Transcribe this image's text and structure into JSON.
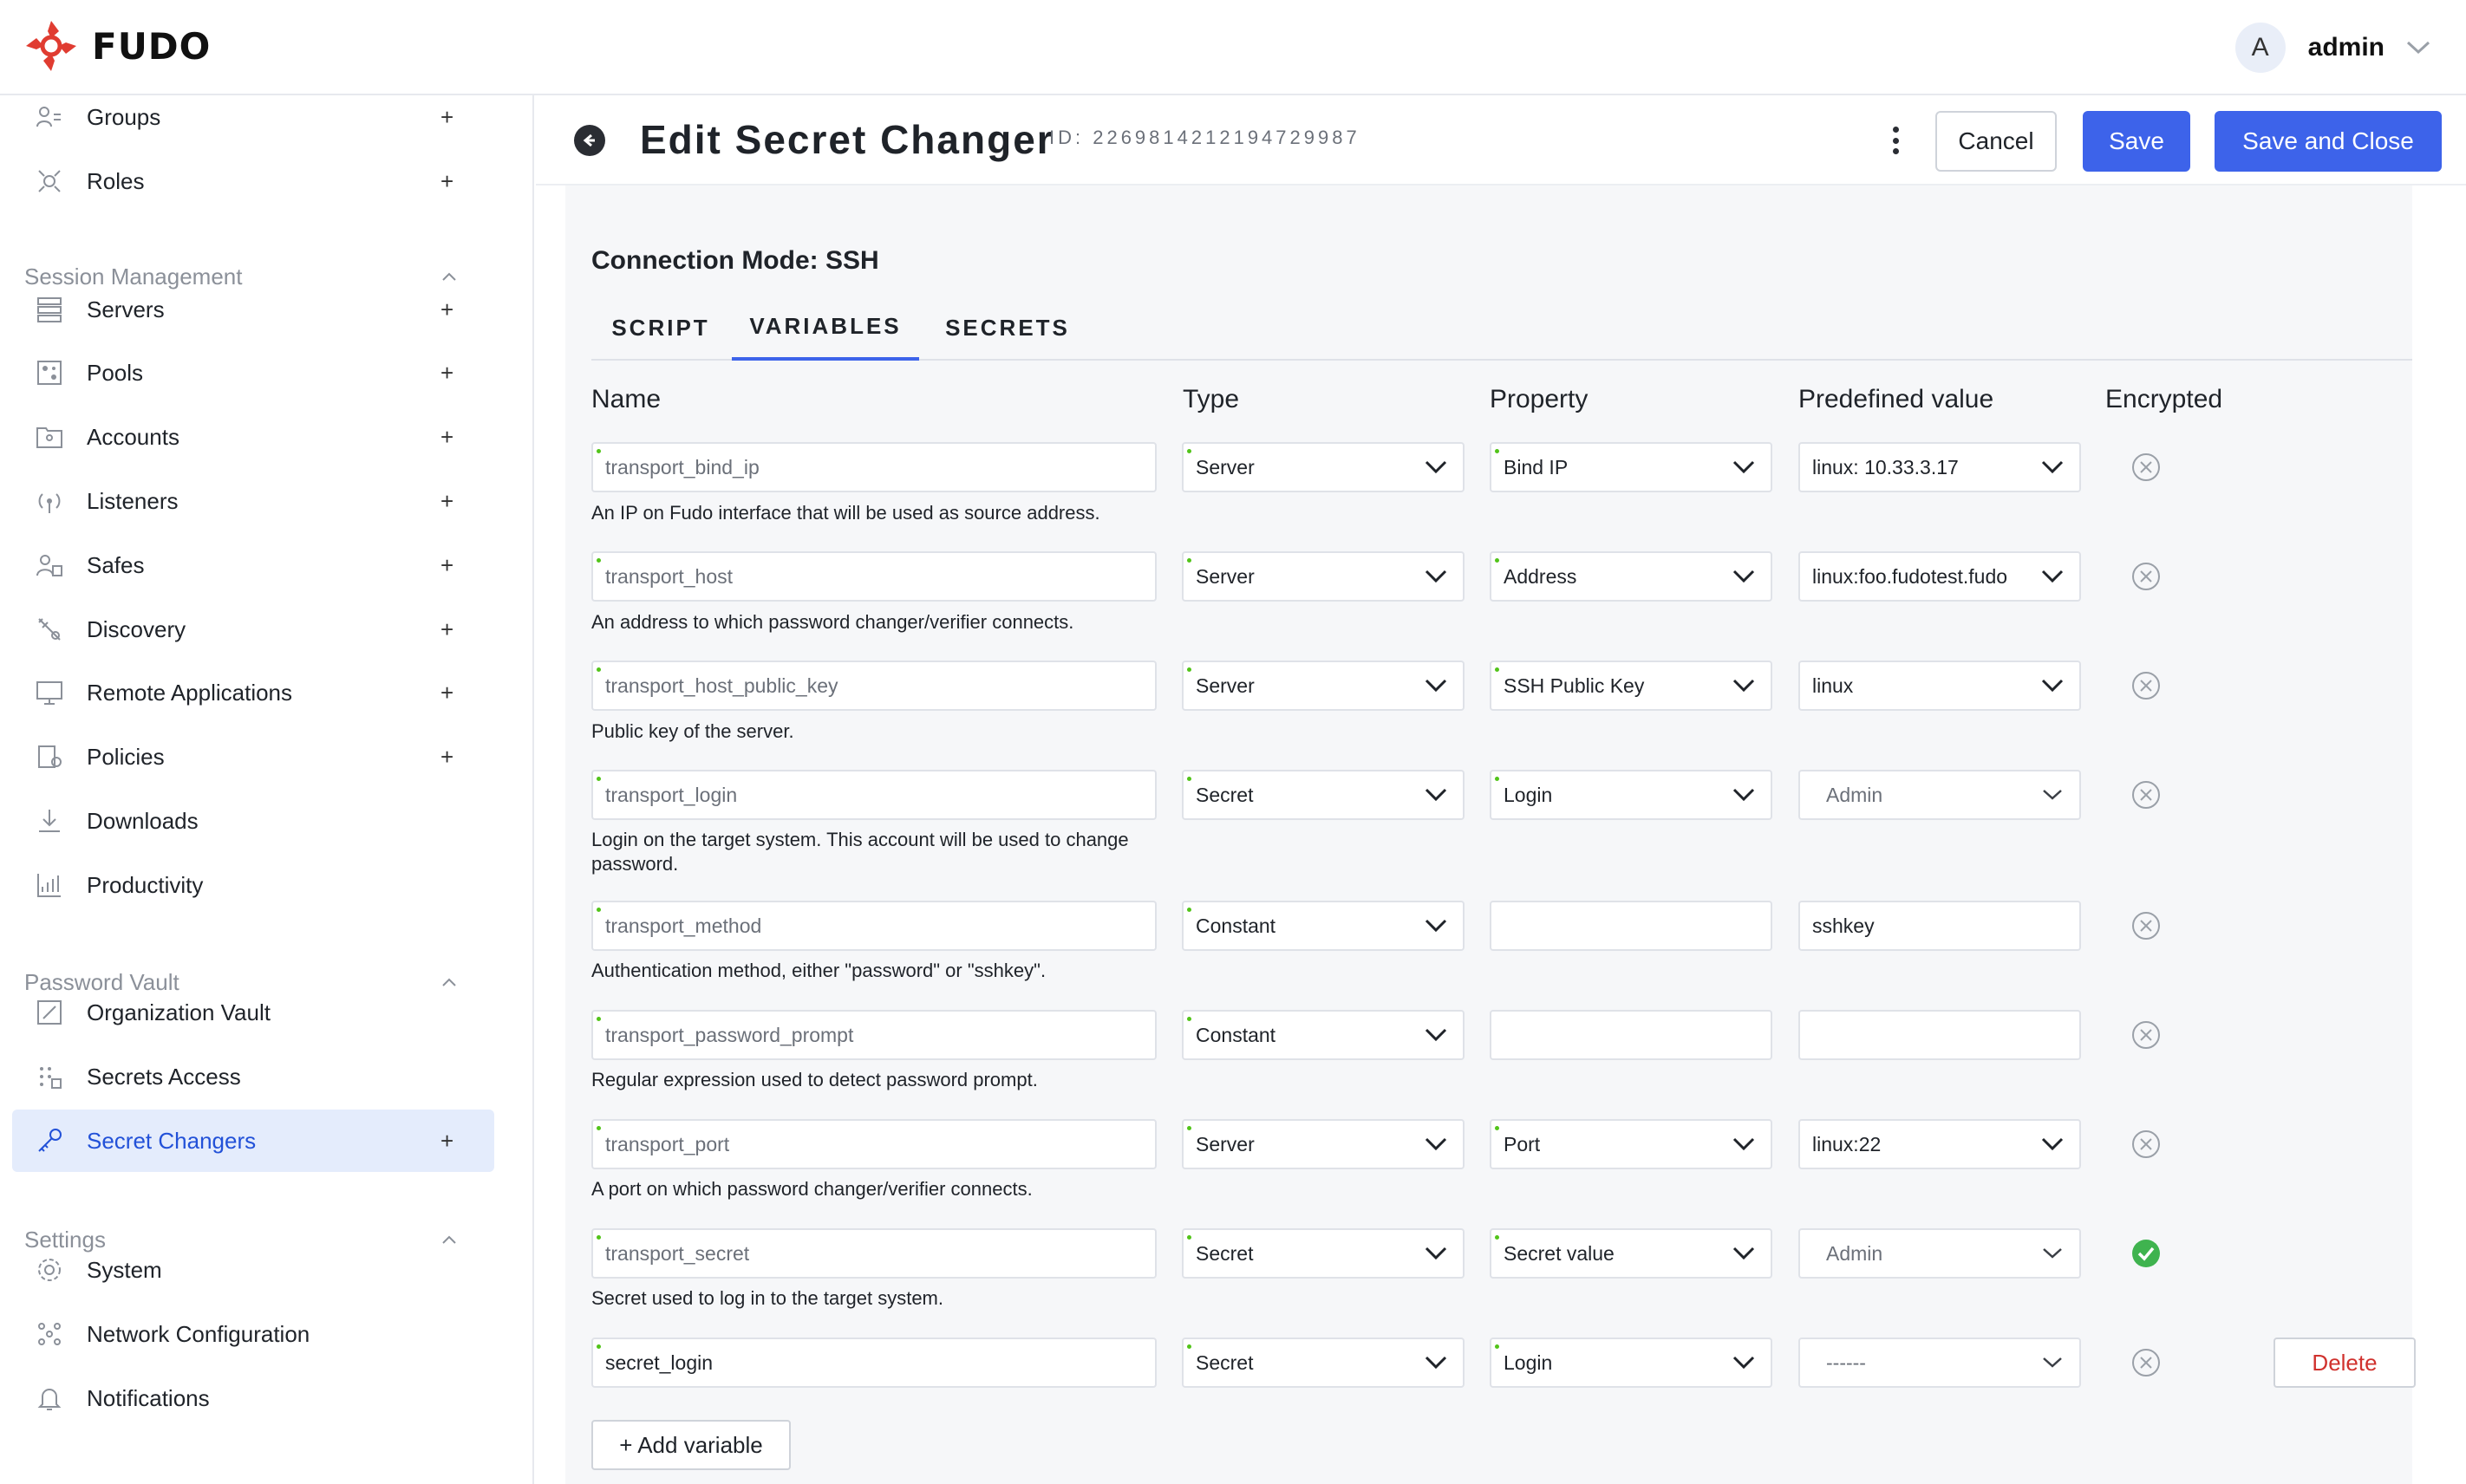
{
  "brand": {
    "name": "FUDO",
    "accent": "#e03c31"
  },
  "user": {
    "initial": "A",
    "name": "admin"
  },
  "sidebar": {
    "items": [
      {
        "key": "groups",
        "label": "Groups",
        "icon": "groups-icon",
        "plus": "+"
      },
      {
        "key": "roles",
        "label": "Roles",
        "icon": "roles-icon",
        "plus": "+"
      },
      {
        "key": "servers",
        "label": "Servers",
        "icon": "servers-icon",
        "plus": "+"
      },
      {
        "key": "pools",
        "label": "Pools",
        "icon": "pools-icon",
        "plus": "+"
      },
      {
        "key": "accounts",
        "label": "Accounts",
        "icon": "accounts-icon",
        "plus": "+"
      },
      {
        "key": "listeners",
        "label": "Listeners",
        "icon": "listeners-icon",
        "plus": "+"
      },
      {
        "key": "safes",
        "label": "Safes",
        "icon": "safes-icon",
        "plus": "+"
      },
      {
        "key": "discovery",
        "label": "Discovery",
        "icon": "discovery-icon",
        "plus": "+"
      },
      {
        "key": "remote",
        "label": "Remote Applications",
        "icon": "remote-applications-icon",
        "plus": "+"
      },
      {
        "key": "policies",
        "label": "Policies",
        "icon": "policies-icon",
        "plus": "+"
      },
      {
        "key": "downloads",
        "label": "Downloads",
        "icon": "downloads-icon",
        "plus": ""
      },
      {
        "key": "productivity",
        "label": "Productivity",
        "icon": "productivity-icon",
        "plus": ""
      },
      {
        "key": "orgvault",
        "label": "Organization Vault",
        "icon": "organization-vault-icon",
        "plus": ""
      },
      {
        "key": "secaccess",
        "label": "Secrets Access",
        "icon": "secrets-access-icon",
        "plus": ""
      },
      {
        "key": "secchangers",
        "label": "Secret Changers",
        "icon": "secret-changers-icon",
        "plus": "+",
        "active": true
      },
      {
        "key": "system",
        "label": "System",
        "icon": "system-gear-icon",
        "plus": ""
      },
      {
        "key": "netconf",
        "label": "Network Configuration",
        "icon": "network-configuration-icon",
        "plus": ""
      },
      {
        "key": "notifications",
        "label": "Notifications",
        "icon": "bell-icon",
        "plus": ""
      }
    ],
    "sections": {
      "session": "Session Management",
      "vault": "Password Vault",
      "settings": "Settings"
    }
  },
  "header": {
    "title": "Edit Secret Changer",
    "id_label": "ID: 2269814212194729987",
    "cancel": "Cancel",
    "save": "Save",
    "save_close": "Save and Close"
  },
  "main": {
    "connection_mode": "Connection Mode: SSH",
    "tabs": [
      "SCRIPT",
      "VARIABLES",
      "SECRETS"
    ],
    "active_tab": "VARIABLES",
    "columns": [
      "Name",
      "Type",
      "Property",
      "Predefined value",
      "Encrypted"
    ],
    "variables": [
      {
        "name": "transport_bind_ip",
        "type": "Server",
        "property": "Bind IP",
        "value": "linux: 10.33.3.17",
        "value_kind": "select",
        "encrypted": false,
        "help": "An IP on Fudo interface that will be used as source address."
      },
      {
        "name": "transport_host",
        "type": "Server",
        "property": "Address",
        "value": "linux:foo.fudotest.fudo",
        "value_kind": "select",
        "encrypted": false,
        "help": "An address to which password changer/verifier connects."
      },
      {
        "name": "transport_host_public_key",
        "type": "Server",
        "property": "SSH Public Key",
        "value": "linux",
        "value_kind": "select",
        "encrypted": false,
        "help": "Public key of the server."
      },
      {
        "name": "transport_login",
        "type": "Secret",
        "property": "Login",
        "value": "Admin",
        "value_kind": "select-muted",
        "encrypted": false,
        "help": "Login on the target system. This account will be used to change password."
      },
      {
        "name": "transport_method",
        "type": "Constant",
        "property": "",
        "value": "sshkey",
        "value_kind": "text",
        "encrypted": false,
        "help": "Authentication method, either \"password\" or \"sshkey\"."
      },
      {
        "name": "transport_password_prompt",
        "type": "Constant",
        "property": "",
        "value": "",
        "value_kind": "text",
        "encrypted": false,
        "help": "Regular expression used to detect password prompt."
      },
      {
        "name": "transport_port",
        "type": "Server",
        "property": "Port",
        "value": "linux:22",
        "value_kind": "select",
        "encrypted": false,
        "help": "A port on which password changer/verifier connects."
      },
      {
        "name": "transport_secret",
        "type": "Secret",
        "property": "Secret value",
        "value": "Admin",
        "value_kind": "select-muted",
        "encrypted": true,
        "help": "Secret used to log in to the target system."
      },
      {
        "name": "secret_login",
        "type": "Secret",
        "property": "Login",
        "value": "------",
        "value_kind": "select-muted",
        "encrypted": false,
        "help": "",
        "deletable": true,
        "name_filled": true
      }
    ],
    "delete_label": "Delete",
    "add_variable": "+ Add variable"
  }
}
